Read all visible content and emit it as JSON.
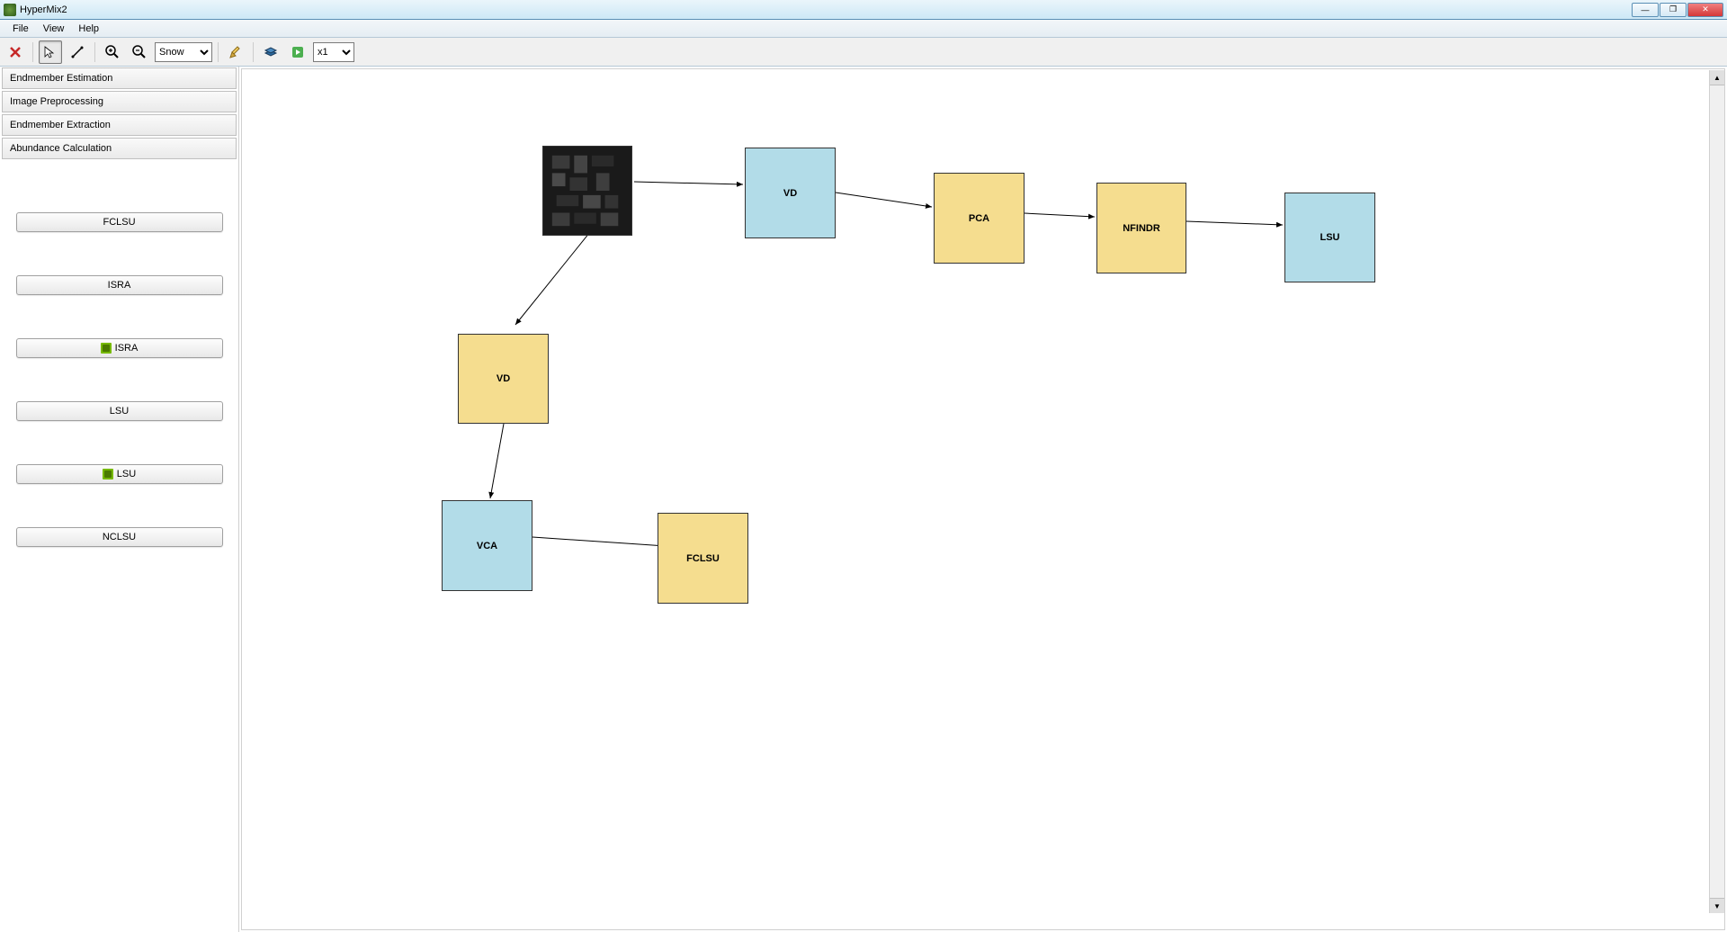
{
  "window": {
    "title": "HyperMix2"
  },
  "menubar": {
    "file": "File",
    "view": "View",
    "help": "Help"
  },
  "toolbar": {
    "theme_select": "Snow",
    "zoom_select": "x1"
  },
  "sidebar": {
    "headers": {
      "estimation": "Endmember Estimation",
      "preprocessing": "Image Preprocessing",
      "extraction": "Endmember Extraction",
      "abundance": "Abundance Calculation"
    },
    "buttons": {
      "fclsu": "FCLSU",
      "isra": "ISRA",
      "isra_gpu": "ISRA",
      "lsu": "LSU",
      "lsu_gpu": "LSU",
      "nclsu": "NCLSU"
    }
  },
  "nodes": {
    "vd1": "VD",
    "pca": "PCA",
    "nfindr": "NFINDR",
    "lsu": "LSU",
    "vd2": "VD",
    "vca": "VCA",
    "fclsu": "FCLSU"
  }
}
